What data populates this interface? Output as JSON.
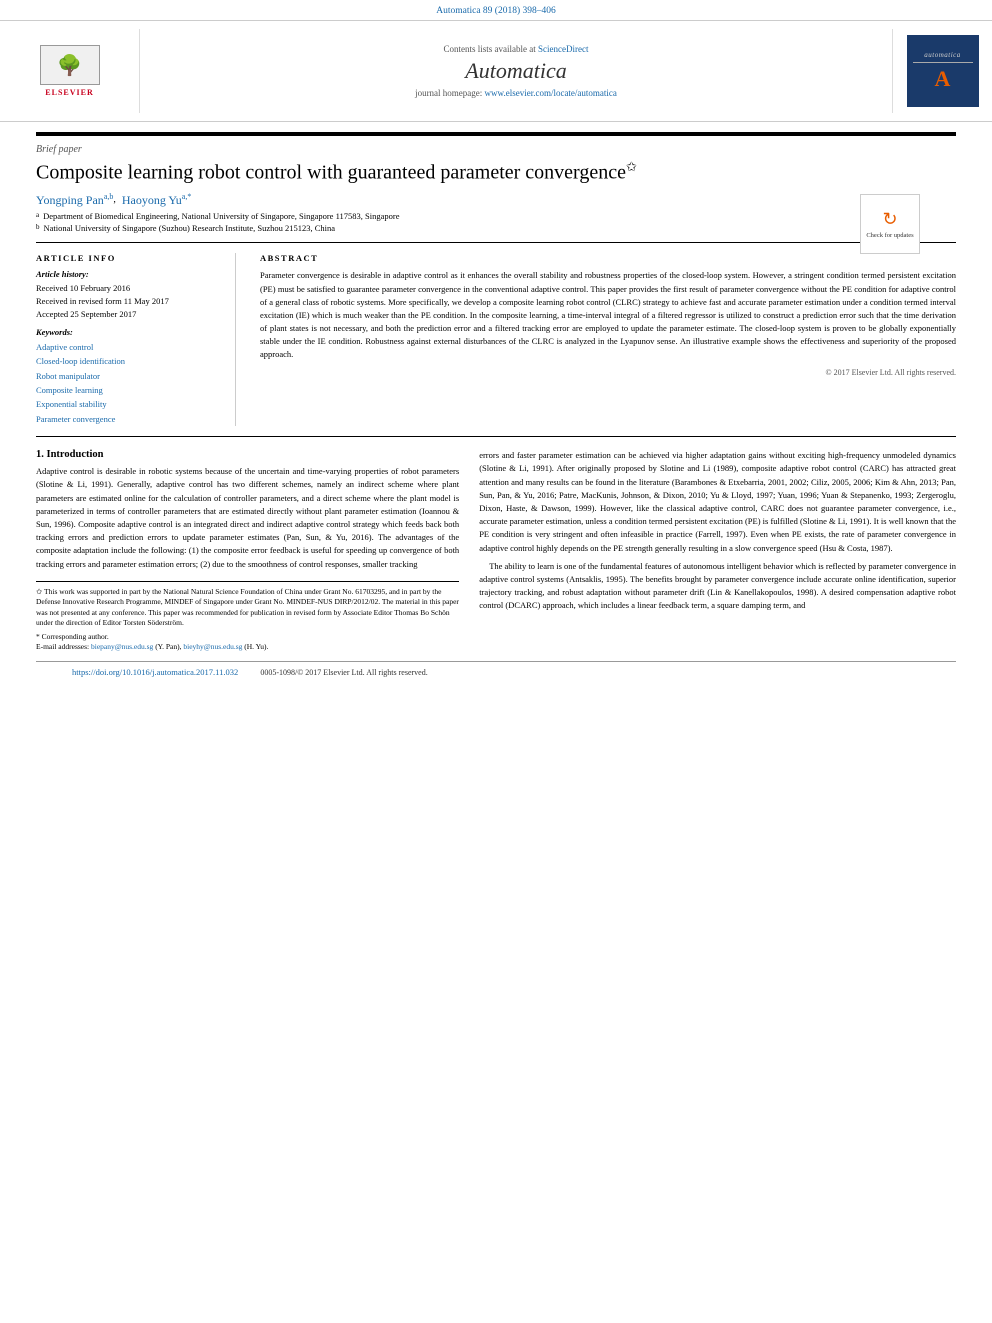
{
  "doi_bar": {
    "text": "Automatica 89 (2018) 398–406"
  },
  "header": {
    "contents_text": "Contents lists available at",
    "sciencedirect_label": "ScienceDirect",
    "journal_title": "Automatica",
    "homepage_text": "journal homepage:",
    "homepage_url": "www.elsevier.com/locate/automatica",
    "elsevier_label": "ELSEVIER",
    "badge_label": "automatica",
    "check_updates_label": "Check for updates"
  },
  "paper": {
    "type_label": "Brief paper",
    "title": "Composite learning robot control with guaranteed parameter convergence",
    "title_star": "✩",
    "author1_name": "Yongping Pan",
    "author1_sup": "a,b",
    "author2_name": "Haoyong Yu",
    "author2_sup": "a,*",
    "affil_a": "Department of Biomedical Engineering, National University of Singapore, Singapore 117583, Singapore",
    "affil_b": "National University of Singapore (Suzhou) Research Institute, Suzhou 215123, China",
    "affil_a_sup": "a",
    "affil_b_sup": "b"
  },
  "article_info": {
    "section_label": "ARTICLE INFO",
    "history_label": "Article history:",
    "received1": "Received 10 February 2016",
    "received2": "Received in revised form 11 May 2017",
    "accepted": "Accepted 25 September 2017",
    "keywords_label": "Keywords:",
    "keywords": [
      "Adaptive control",
      "Closed-loop identification",
      "Robot manipulator",
      "Composite learning",
      "Exponential stability",
      "Parameter convergence"
    ]
  },
  "abstract": {
    "section_label": "ABSTRACT",
    "text": "Parameter convergence is desirable in adaptive control as it enhances the overall stability and robustness properties of the closed-loop system. However, a stringent condition termed persistent excitation (PE) must be satisfied to guarantee parameter convergence in the conventional adaptive control. This paper provides the first result of parameter convergence without the PE condition for adaptive control of a general class of robotic systems. More specifically, we develop a composite learning robot control (CLRC) strategy to achieve fast and accurate parameter estimation under a condition termed interval excitation (IE) which is much weaker than the PE condition. In the composite learning, a time-interval integral of a filtered regressor is utilized to construct a prediction error such that the time derivation of plant states is not necessary, and both the prediction error and a filtered tracking error are employed to update the parameter estimate. The closed-loop system is proven to be globally exponentially stable under the IE condition. Robustness against external disturbances of the CLRC is analyzed in the Lyapunov sense. An illustrative example shows the effectiveness and superiority of the proposed approach.",
    "copyright": "© 2017 Elsevier Ltd. All rights reserved."
  },
  "intro": {
    "section_number": "1.",
    "section_title": "Introduction",
    "left_col_p1": "Adaptive control is desirable in robotic systems because of the uncertain and time-varying properties of robot parameters (Slotine & Li, 1991). Generally, adaptive control has two different schemes, namely an indirect scheme where plant parameters are estimated online for the calculation of controller parameters, and a direct scheme where the plant model is parameterized in terms of controller parameters that are estimated directly without plant parameter estimation (Ioannou & Sun, 1996). Composite adaptive control is an integrated direct and indirect adaptive control strategy which feeds back both tracking errors and prediction errors to update parameter estimates (Pan, Sun, & Yu, 2016). The advantages of the composite adaptation include the following: (1) the composite error feedback is useful for speeding up convergence of both tracking errors and parameter estimation errors; (2) due to the smoothness of control responses, smaller tracking",
    "right_col_p1": "errors and faster parameter estimation can be achieved via higher adaptation gains without exciting high-frequency unmodeled dynamics (Slotine & Li, 1991). After originally proposed by Slotine and Li (1989), composite adaptive robot control (CARC) has attracted great attention and many results can be found in the literature (Barambones & Etxebarria, 2001, 2002; Ciliz, 2005, 2006; Kim & Ahn, 2013; Pan, Sun, Pan, & Yu, 2016; Patre, MacKunis, Johnson, & Dixon, 2010; Yu & Lloyd, 1997; Yuan, 1996; Yuan & Stepanenko, 1993; Zergeroglu, Dixon, Haste, & Dawson, 1999). However, like the classical adaptive control, CARC does not guarantee parameter convergence, i.e., accurate parameter estimation, unless a condition termed persistent excitation (PE) is fulfilled (Slotine & Li, 1991). It is well known that the PE condition is very stringent and often infeasible in practice (Farrell, 1997). Even when PE exists, the rate of parameter convergence in adaptive control highly depends on the PE strength generally resulting in a slow convergence speed (Hsu & Costa, 1987).",
    "right_col_p2": "The ability to learn is one of the fundamental features of autonomous intelligent behavior which is reflected by parameter convergence in adaptive control systems (Antsaklis, 1995). The benefits brought by parameter convergence include accurate online identification, superior trajectory tracking, and robust adaptation without parameter drift (Lin & Kanellakopoulos, 1998). A desired compensation adaptive robot control (DCARC) approach, which includes a linear feedback term, a square damping term, and"
  },
  "footnote": {
    "star_note": "✩ This work was supported in part by the National Natural Science Foundation of China under Grant No. 61703295, and in part by the Defense Innovative Research Programme, MINDEF of Singapore under Grant No. MINDEF-NUS DIRP/2012/02. The material in this paper was not presented at any conference. This paper was recommended for publication in revised form by Associate Editor Thomas Bo Schön under the direction of Editor Torsten Söderström.",
    "corresponding_note": "* Corresponding author.",
    "email_label": "E-mail addresses:",
    "email1": "biepany@nus.edu.sg",
    "email1_name": "(Y. Pan),",
    "email2": "bieyhy@nus.edu.sg",
    "email2_name": "(H. Yu)."
  },
  "bottom_bar": {
    "doi_link": "https://doi.org/10.1016/j.automatica.2017.11.032",
    "issn_text": "0005-1098/© 2017 Elsevier Ltd. All rights reserved."
  }
}
